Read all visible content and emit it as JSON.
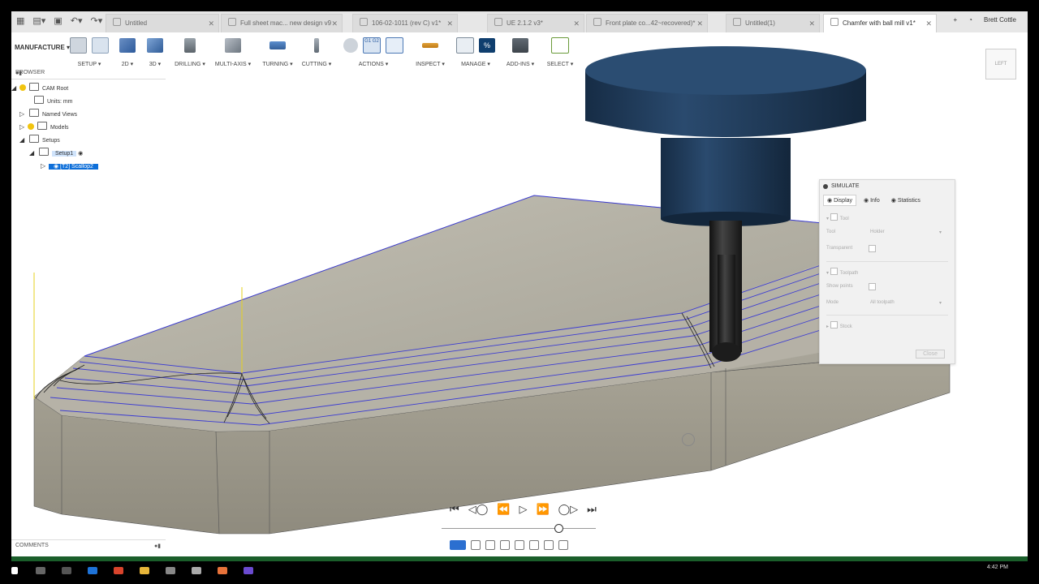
{
  "tabs": [
    {
      "label": "Untitled"
    },
    {
      "label": "Full sheet mac... new design v9"
    },
    {
      "label": "106-02-1011 (rev C) v1*"
    },
    {
      "label": "UE 2.1.2 v3*"
    },
    {
      "label": "Front plate co...42~recovered)*"
    },
    {
      "label": "Untitled(1)"
    },
    {
      "label": "Chamfer with ball mill v1*"
    }
  ],
  "user": "Brett Cottle",
  "toolbar": {
    "workspace": "MANUFACTURE ▾",
    "groups": [
      "SETUP ▾",
      "2D ▾",
      "3D ▾",
      "DRILLING ▾",
      "MULTI-AXIS ▾",
      "TURNING ▾",
      "CUTTING ▾",
      "ACTIONS ▾",
      "INSPECT ▾",
      "MANAGE ▾",
      "ADD-INS ▾",
      "SELECT ▾"
    ]
  },
  "browser": {
    "title": "BROWSER",
    "root": "CAM Root",
    "units": "Units: mm",
    "named_views": "Named Views",
    "models": "Models",
    "setups": "Setups",
    "setup1": "Setup1",
    "operation": "[T2] Scallop2"
  },
  "simulate": {
    "title": "SIMULATE",
    "tabs": [
      "Display",
      "Info",
      "Statistics"
    ],
    "tool_section": "Tool",
    "tool_label": "Tool",
    "tool_value": "Holder",
    "transparent_label": "Transparent",
    "toolpath_section": "Toolpath",
    "show_points_label": "Show points",
    "mode_label": "Mode",
    "mode_value": "All toolpath",
    "stock_section": "Stock",
    "close_label": "Close"
  },
  "comments": "COMMENTS",
  "viewcube": "LEFT",
  "clock": "4:42 PM",
  "colors": {
    "tool_body": "#1f3a57",
    "shank": "#2a2a2a",
    "toolpath": "#3c3cd2",
    "part": "#a8a496",
    "accent": "#0e6fd9"
  }
}
